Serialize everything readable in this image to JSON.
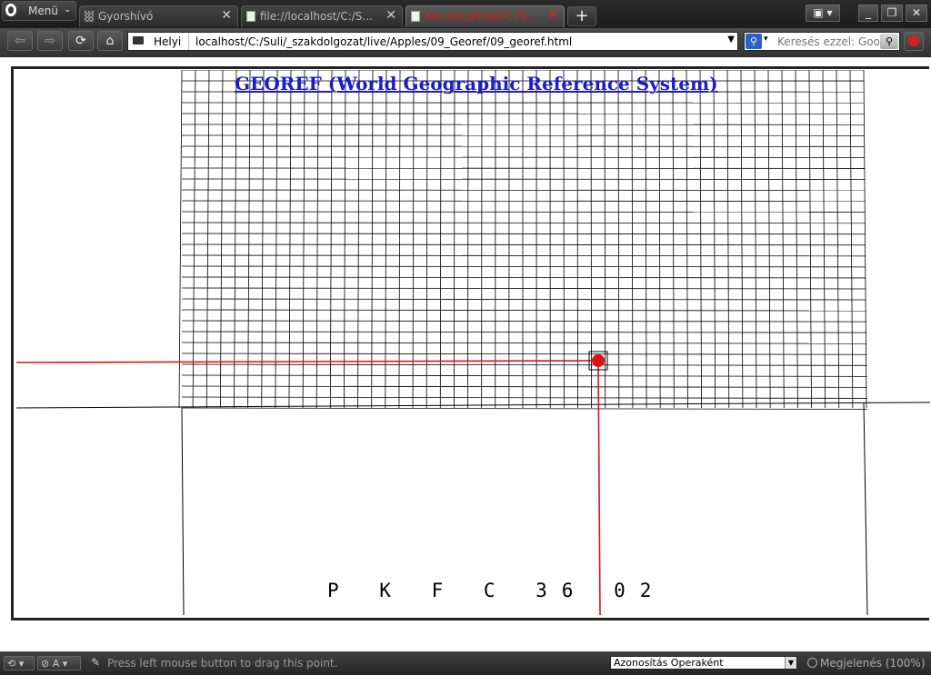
{
  "browser": {
    "menu_label": "Menü",
    "tabs": [
      {
        "label": "Gyorshívó",
        "icon": "speed-dial-icon",
        "active": false
      },
      {
        "label": "file://localhost/C:/S...",
        "icon": "page-icon",
        "active": false
      },
      {
        "label": "file://localhost/C:/S...",
        "icon": "page-icon",
        "active": true
      }
    ],
    "new_tab_label": "+",
    "address": {
      "site_label": "Helyi",
      "url": "localhost/C:/Suli/_szakdolgozat/live/Apples/09_Georef/09_georef.html"
    },
    "search": {
      "placeholder": "Keresés ezzel: Goo"
    }
  },
  "applet": {
    "title": "GEOREF (World Geographic Reference System)",
    "code": "P K F C 36 02",
    "colors": {
      "title": "#1c1ccc",
      "crosshair": "#e01010",
      "grid": "#000000"
    }
  },
  "statusbar": {
    "message": "Press left mouse button to drag this point.",
    "identity": "Azonosítás Operaként",
    "zoom": "Megjelenés (100%)",
    "view_toggle": "A"
  }
}
